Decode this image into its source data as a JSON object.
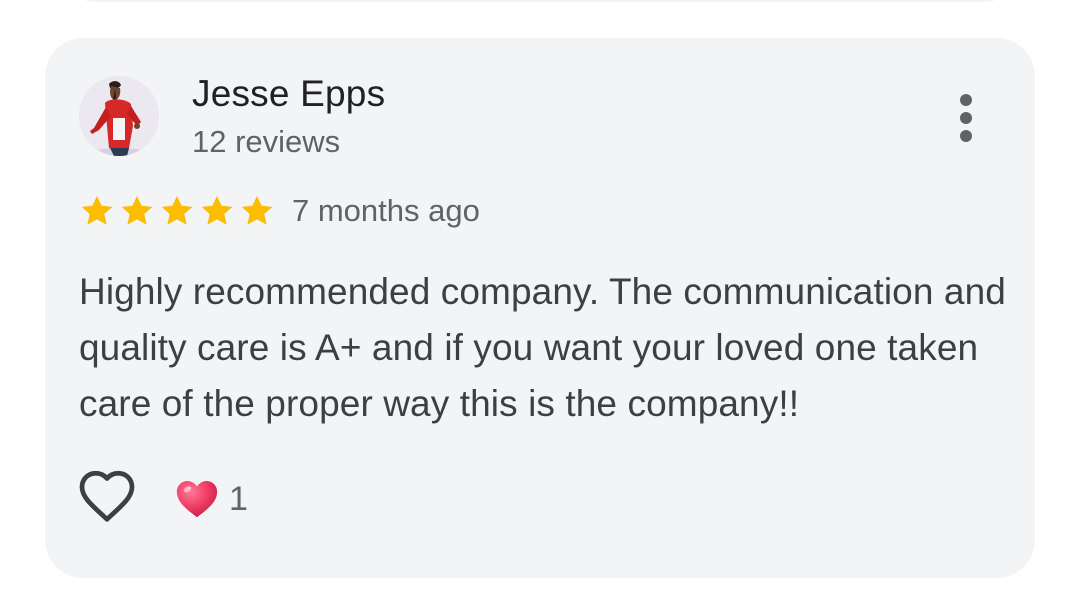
{
  "review": {
    "author": {
      "name": "Jesse Epps",
      "reviews_count": "12 reviews",
      "avatar": "person-in-red-jacket-photo"
    },
    "menu_icon": "more-vert-icon",
    "rating": {
      "stars": 5,
      "max": 5,
      "color": "#fbbc04"
    },
    "date": "7 months ago",
    "text": "Highly recommended company. The communication and quality care is A+ and if you want your loved one taken care of the proper way this is the company!!",
    "actions": {
      "like_icon": "heart-outline-icon",
      "reaction_icon": "red-heart-emoji-icon",
      "reaction_count": "1"
    }
  },
  "colors": {
    "card_background": "#f3f4f6",
    "primary_text": "#202124",
    "secondary_text": "#5f6368",
    "star": "#fbbc04",
    "heart": "#f03e64"
  }
}
